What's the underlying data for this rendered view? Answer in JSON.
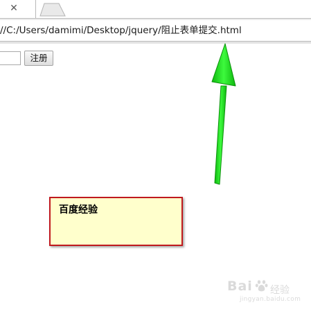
{
  "browser": {
    "tab_close_glyph": "✕",
    "address": {
      "url": "//C:/Users/damimi/Desktop/jquery/阻止表单提交.html"
    }
  },
  "page": {
    "text_input_value": "",
    "register_button_label": "注册"
  },
  "annotation": {
    "note_text": "百度经验",
    "arrow_color": "#1ee01e",
    "note_border_color": "#c0181e",
    "note_background": "#ffffcc"
  },
  "watermark": {
    "brand": "Bai",
    "label": "经验",
    "sub": "jingyan.baidu.com",
    "icon": "baidu-paw-icon"
  }
}
